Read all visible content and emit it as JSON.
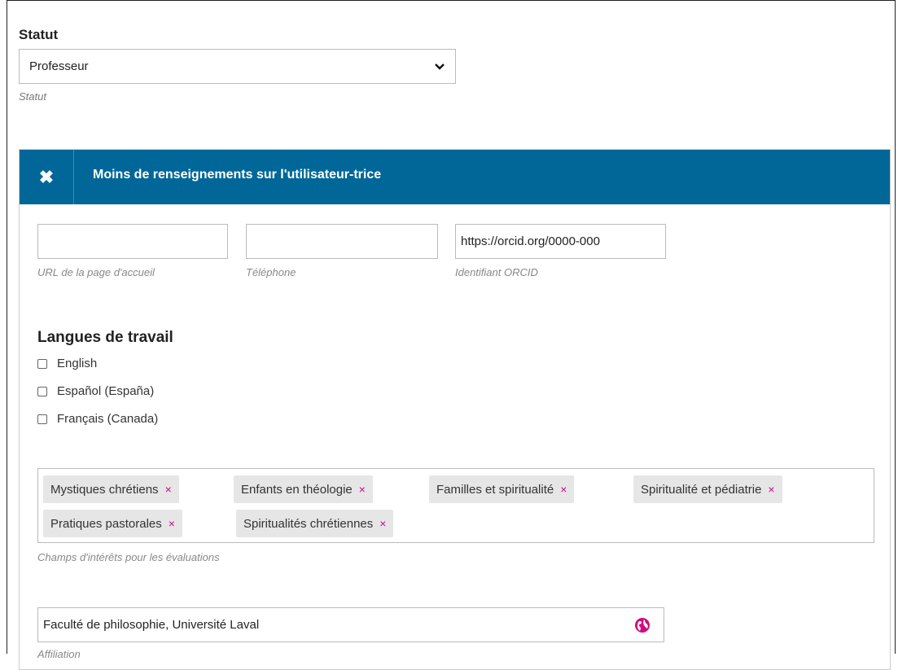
{
  "status": {
    "label": "Statut",
    "selected": "Professeur",
    "help": "Statut"
  },
  "panel": {
    "close_glyph": "✖",
    "title": "Moins de renseignements sur l'utilisateur-trice"
  },
  "fields": {
    "homepage": {
      "value": "",
      "help": "URL de la page d'accueil"
    },
    "phone": {
      "value": "",
      "help": "Téléphone"
    },
    "orcid": {
      "value": "https://orcid.org/0000-000",
      "help": "Identifiant ORCID"
    }
  },
  "languages": {
    "title": "Langues de travail",
    "items": [
      {
        "label": "English",
        "checked": false
      },
      {
        "label": "Español (España)",
        "checked": false
      },
      {
        "label": "Français (Canada)",
        "checked": false
      }
    ]
  },
  "interests": {
    "tags": [
      "Mystiques chrétiens",
      "Enfants en théologie",
      "Familles et spiritualité",
      "Spiritualité et pédiatrie",
      "Pratiques pastorales",
      "Spiritualités chrétiennes"
    ],
    "remove_glyph": "×",
    "help": "Champs d'intérêts pour les évaluations"
  },
  "affiliation": {
    "value": "Faculté de philosophie, Université Laval",
    "help": "Affiliation"
  },
  "colors": {
    "header": "#006798",
    "tag_remove": "#d00b80"
  },
  "icons": {
    "select_arrow": "chevron-down-icon",
    "close": "close-icon",
    "globe": "globe-icon"
  }
}
